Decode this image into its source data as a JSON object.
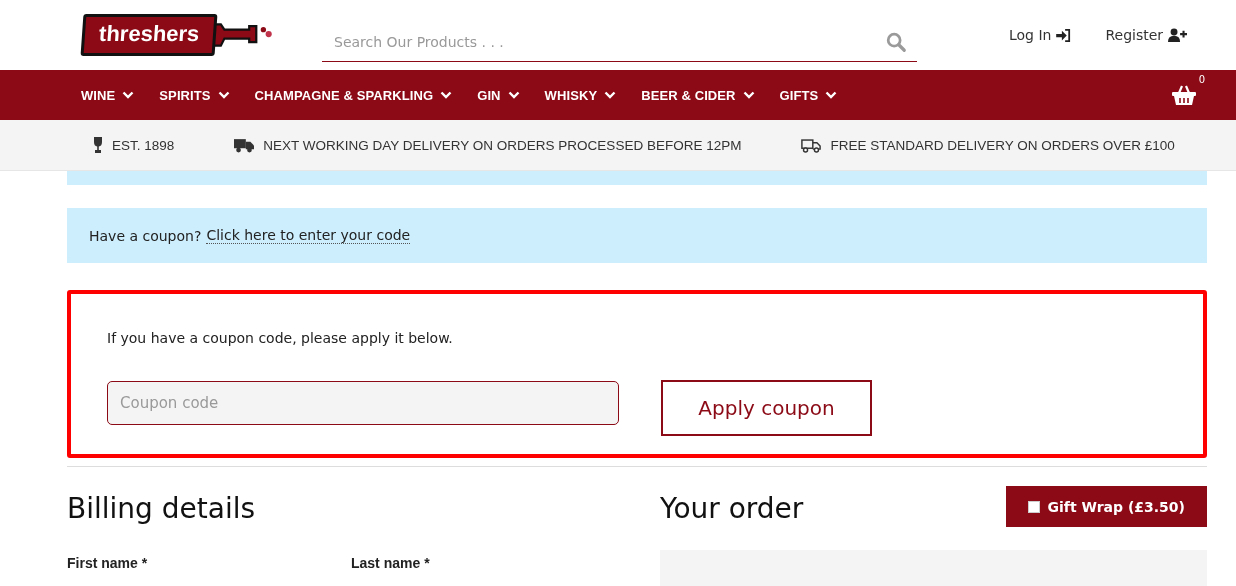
{
  "header": {
    "logo": "threshers",
    "search": {
      "placeholder": "Search Our Products . . ."
    },
    "account_links": [
      {
        "label": "Log In",
        "kind": "login"
      },
      {
        "label": "Register",
        "kind": "register"
      }
    ]
  },
  "nav": {
    "items": [
      {
        "label": "WINE"
      },
      {
        "label": "SPIRITS"
      },
      {
        "label": "CHAMPAGNE & SPARKLING"
      },
      {
        "label": "GIN"
      },
      {
        "label": "WHISKY"
      },
      {
        "label": "BEER & CIDER"
      },
      {
        "label": "GIFTS"
      }
    ],
    "cart_count": "0"
  },
  "info_bar": [
    {
      "kind": "glass",
      "text": "EST. 1898"
    },
    {
      "kind": "truck",
      "text": "NEXT WORKING DAY DELIVERY ON ORDERS PROCESSED BEFORE 12PM"
    },
    {
      "kind": "truck-outline",
      "text": "FREE STANDARD DELIVERY ON ORDERS OVER £100"
    }
  ],
  "coupon_notice": {
    "text": "Have a coupon?",
    "link": "Click here to enter your code"
  },
  "coupon_form": {
    "prompt": "If you have a coupon code, please apply it below.",
    "placeholder": "Coupon code",
    "button": "Apply coupon"
  },
  "billing": {
    "title": "Billing details",
    "fields": [
      {
        "label": "First name *"
      },
      {
        "label": "Last name *"
      }
    ]
  },
  "order": {
    "title": "Your order",
    "gift_wrap": {
      "label": "Gift Wrap (£3.50)",
      "checked": false
    }
  }
}
